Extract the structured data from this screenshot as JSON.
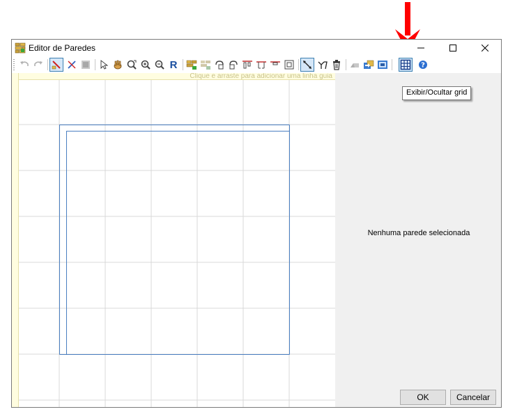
{
  "window": {
    "title": "Editor de Paredes",
    "controls": {
      "minimize": "—",
      "maximize": "☐",
      "close": "✕"
    }
  },
  "toolbar": {
    "items": [
      {
        "name": "undo-icon"
      },
      {
        "name": "redo-icon"
      },
      {
        "name": "draw-wall-icon",
        "active": true
      },
      {
        "name": "split-wall-icon"
      },
      {
        "name": "wall-texture-icon"
      },
      {
        "name": "select-pointer-icon"
      },
      {
        "name": "pan-hand-icon"
      },
      {
        "name": "zoom-window-icon"
      },
      {
        "name": "zoom-in-icon"
      },
      {
        "name": "zoom-out-icon"
      },
      {
        "name": "reset-view-icon",
        "label": "R"
      },
      {
        "name": "join-walls-icon"
      },
      {
        "name": "merge-walls-icon"
      },
      {
        "name": "rotate-left-icon"
      },
      {
        "name": "rotate-right-icon"
      },
      {
        "name": "align-top-icon"
      },
      {
        "name": "align-middle-icon"
      },
      {
        "name": "align-bottom-icon"
      },
      {
        "name": "snap-icon"
      },
      {
        "name": "measure-icon",
        "active": true
      },
      {
        "name": "angle-icon"
      },
      {
        "name": "delete-icon"
      },
      {
        "name": "roof-icon"
      },
      {
        "name": "import-icon"
      },
      {
        "name": "export-icon"
      },
      {
        "name": "grid-icon",
        "active": true
      },
      {
        "name": "help-icon"
      }
    ]
  },
  "canvas": {
    "guide_hint": "Clique e arraste para adicionar uma linha guia"
  },
  "tooltip": {
    "text": "Exibir/Ocultar grid"
  },
  "properties": {
    "empty_message": "Nenhuma parede selecionada",
    "ok_label": "OK",
    "cancel_label": "Cancelar"
  },
  "colors": {
    "arrow": "#ff0000",
    "wall_line": "#4a7fc1",
    "grid_line": "#d9d9d9",
    "ruler": "#fffde0"
  }
}
